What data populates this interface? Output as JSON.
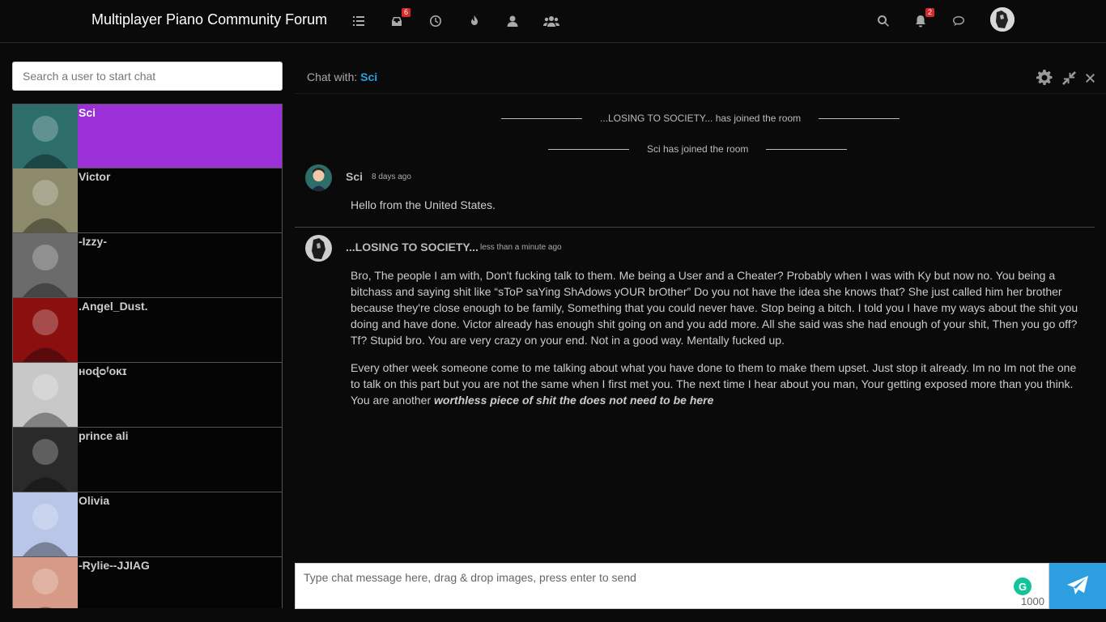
{
  "header": {
    "brand": "Multiplayer Piano Community Forum",
    "nav_icons": [
      "categories-icon",
      "inbox-icon",
      "recent-icon",
      "popular-icon",
      "user-icon",
      "groups-icon"
    ],
    "inbox_badge": "6",
    "notifications_badge": "2",
    "right_icons": [
      "search-icon",
      "bell-icon",
      "chat-icon"
    ]
  },
  "sidebar": {
    "search_placeholder": "Search a user to start chat",
    "users": [
      {
        "name": "Sci",
        "active": true,
        "color": "#2d6e6b"
      },
      {
        "name": "Victor",
        "active": false,
        "color": "#8c8a6a"
      },
      {
        "name": "-Izzy-",
        "active": false,
        "color": "#6b6b6b"
      },
      {
        "name": ".Angel_Dust.",
        "active": false,
        "color": "#8a1010"
      },
      {
        "name": "ʜᴏɖᴑᶠᴏĸɪ",
        "active": false,
        "color": "#c8c8c8"
      },
      {
        "name": "prince ali",
        "active": false,
        "color": "#2a2a2a"
      },
      {
        "name": "Olivia",
        "active": false,
        "color": "#b9c6e8"
      },
      {
        "name": "-Rylie--JJIAG",
        "active": false,
        "color": "#d79a86"
      }
    ]
  },
  "chat": {
    "with_label": "Chat with:",
    "with_user": "Sci",
    "system_messages": [
      "...LOSING TO SOCIETY... has joined the room",
      "Sci has joined the room"
    ],
    "messages": [
      {
        "author": "Sci",
        "time": "8 days ago",
        "paragraphs": [
          "Hello from the United States."
        ]
      },
      {
        "author": "...LOSING TO SOCIETY...",
        "time": "less than a minute ago",
        "paragraphs": [
          "Bro, The people I am with, Don't fucking talk to them. Me being a User and a Cheater? Probably when I was with Ky but now no. You being a bitchass and saying shit like “sToP saYing ShAdows yOUR brOther” Do you not have the idea she knows that? She just called him her brother because they're close enough to be family, Something that you could never have. Stop being a bitch. I told you I have my ways about the shit you doing and have done. Victor already has enough shit going on and you add more. All she said was she had enough of your shit, Then you go off? Tf? Stupid bro. You are very crazy on your end. Not in a good way. Mentally fucked up.",
          "Every other week someone come to me talking about what you have done to them to make them upset. Just stop it already. Im no Im not the one to talk on this part but you are not the same when I first met you. The next time I hear about you man, Your getting exposed more than you think. You are another "
        ],
        "emphasis": "worthless piece of shit the does not need to be here"
      }
    ],
    "composer_placeholder": "Type chat message here, drag & drop images, press enter to send",
    "char_limit": "1000",
    "grammarly_letter": "G"
  }
}
